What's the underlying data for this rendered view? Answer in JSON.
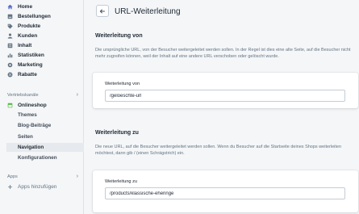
{
  "sidebar": {
    "items": [
      {
        "label": "Home",
        "icon": "home-icon"
      },
      {
        "label": "Bestellungen",
        "icon": "orders-icon"
      },
      {
        "label": "Produkte",
        "icon": "tag-icon"
      },
      {
        "label": "Kunden",
        "icon": "person-icon"
      },
      {
        "label": "Inhalt",
        "icon": "content-icon"
      },
      {
        "label": "Statistiken",
        "icon": "chart-icon"
      },
      {
        "label": "Marketing",
        "icon": "marketing-icon"
      },
      {
        "label": "Rabatte",
        "icon": "discount-icon"
      }
    ],
    "sales_channels_label": "Vertriebskanäle",
    "online_store": {
      "label": "Onlineshop",
      "subitems": [
        "Themes",
        "Blog-Beiträge",
        "Seiten",
        "Navigation",
        "Konfigurationen"
      ],
      "active": "Navigation"
    },
    "apps_label": "Apps",
    "add_apps_label": "Apps hinzufügen"
  },
  "main": {
    "title": "URL-Weiterleitung",
    "from_section": {
      "title": "Weiterleitung von",
      "description": "Die ursprüngliche URL, von der Besucher weitergeleitet werden sollen. In der Regel ist dies eine alte Seite, auf die Besucher nicht mehr zugreifen können, weil der Inhalt auf eine andere URL verschoben oder gelöscht wurde.",
      "field_label": "Weiterleitung von",
      "value": "/geloeschte-url"
    },
    "to_section": {
      "title": "Weiterleitung zu",
      "description": "Die neue URL, auf die Besucher weitergeleitet werden sollen. Wenn du Besucher auf die Startseite deines Shops weiterleiten möchtest, dann gib / (einen Schrägstrich) ein.",
      "field_label": "Weiterleitung zu",
      "value": "/products/klassische-eheringe"
    }
  },
  "colors": {
    "active_nav_bg": "#e6e9ed",
    "online_store_icon": "#50b83c",
    "page_bg": "#f4f6f8"
  }
}
